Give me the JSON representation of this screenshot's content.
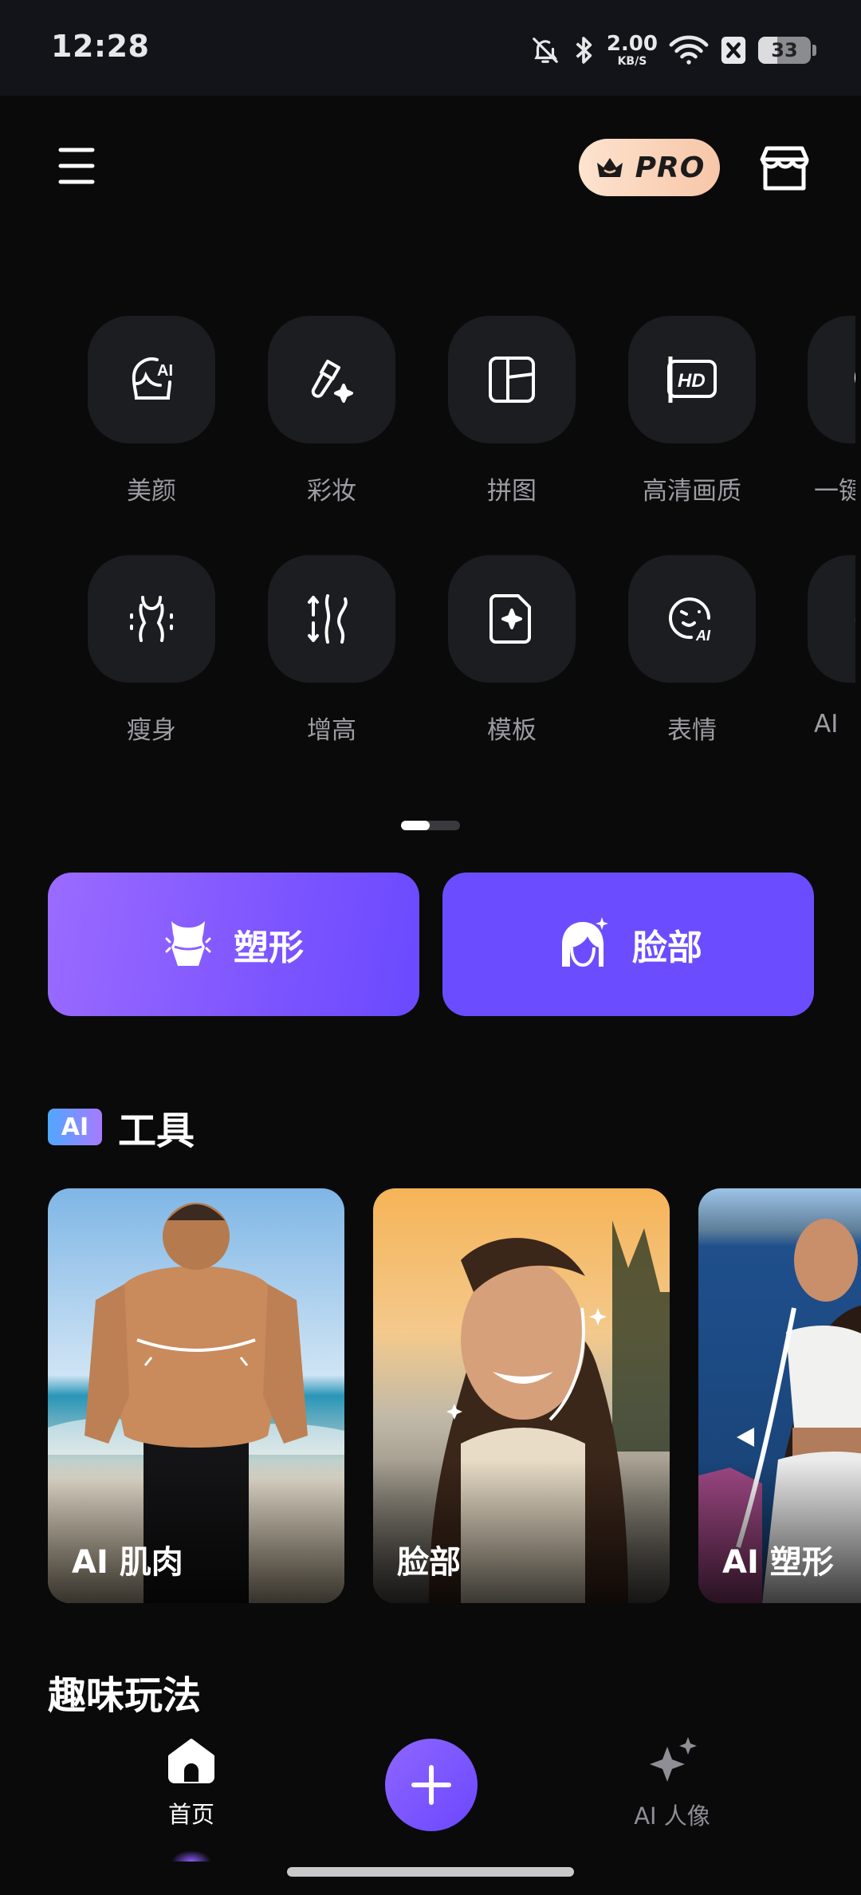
{
  "status_bar": {
    "time": "12:28",
    "net_speed_value": "2.00",
    "net_speed_unit": "KB/S",
    "battery_level": "33",
    "icons": [
      "bell-muted-icon",
      "bluetooth-icon",
      "wifi-icon",
      "sim-off-icon",
      "battery-icon"
    ]
  },
  "header": {
    "pro_label": "PRO",
    "menu_icon": "hamburger-menu-icon",
    "store_icon": "store-icon"
  },
  "tools_row1": [
    {
      "label": "美颜",
      "icon": "ai-face-icon"
    },
    {
      "label": "彩妆",
      "icon": "makeup-brush-icon"
    },
    {
      "label": "拼图",
      "icon": "collage-icon"
    },
    {
      "label": "高清画质",
      "icon": "hd-icon"
    },
    {
      "label": "一键",
      "icon": "one-tap-icon"
    }
  ],
  "tools_row2": [
    {
      "label": "瘦身",
      "icon": "slim-body-icon"
    },
    {
      "label": "增高",
      "icon": "height-icon"
    },
    {
      "label": "模板",
      "icon": "template-icon"
    },
    {
      "label": "表情",
      "icon": "expression-icon"
    },
    {
      "label": "AI",
      "icon": "ai-tool-icon"
    }
  ],
  "pager": {
    "pages": 2,
    "active": 1
  },
  "feature_buttons": {
    "shape": "塑形",
    "face": "脸部"
  },
  "ai_tools": {
    "badge": "AI",
    "title": "工具",
    "cards": [
      {
        "label": "AI 肌肉"
      },
      {
        "label": "脸部"
      },
      {
        "label": "AI 塑形"
      }
    ]
  },
  "fun_section": {
    "title": "趣味玩法"
  },
  "bottom_nav": {
    "home": "首页",
    "ai_portrait": "AI 人像"
  },
  "colors": {
    "background": "#0a0a0b",
    "accent_purple": "#6b4dff",
    "pro_badge": "#fde3cf"
  }
}
